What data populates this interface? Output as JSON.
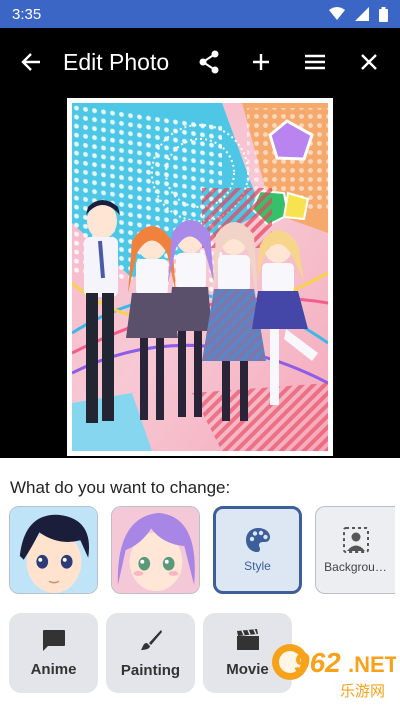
{
  "status": {
    "time": "3:35",
    "icons": [
      "wifi-icon",
      "signal-icon",
      "battery-icon"
    ]
  },
  "toolbar": {
    "title": "Edit Photo",
    "icons": [
      "back-arrow-icon",
      "share-icon",
      "add-icon",
      "menu-icon",
      "close-icon"
    ]
  },
  "panel": {
    "question": "What do you want to change:",
    "tiles": [
      {
        "kind": "image",
        "name": "boy-face"
      },
      {
        "kind": "image",
        "name": "girl-face"
      },
      {
        "kind": "option",
        "label": "Style",
        "icon": "palette-icon",
        "selected": true
      },
      {
        "kind": "option",
        "label": "Backgrou…",
        "icon": "background-icon",
        "selected": false
      }
    ],
    "styles": [
      {
        "label": "Anime",
        "icon": "chat-bubble-icon"
      },
      {
        "label": "Painting",
        "icon": "brush-icon"
      },
      {
        "label": "Movie",
        "icon": "clapperboard-icon"
      }
    ]
  },
  "watermark": {
    "text": "962.NET",
    "subtext": "乐游网"
  },
  "colors": {
    "status_bar": "#3c66c6",
    "accent": "#3c5e9b",
    "tile_bg": "#eceef2",
    "selected_bg": "#dde6f3"
  }
}
